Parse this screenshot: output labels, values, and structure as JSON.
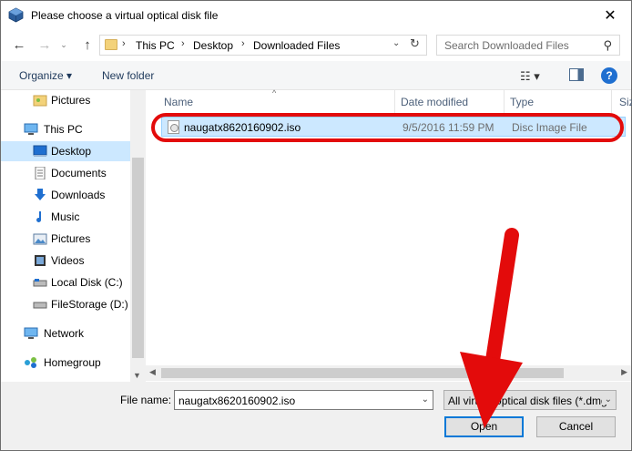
{
  "window": {
    "title": "Please choose a virtual optical disk file",
    "close_glyph": "✕"
  },
  "address": {
    "breadcrumbs": [
      "This PC",
      "Desktop",
      "Downloaded Files"
    ],
    "separator": "›"
  },
  "search": {
    "placeholder": "Search Downloaded Files"
  },
  "toolbar": {
    "organize_label": "Organize ▾",
    "new_folder_label": "New folder",
    "help_glyph": "?"
  },
  "sidebar": {
    "items": [
      {
        "label": "Pictures",
        "icon": "pictures-icon"
      },
      {
        "label": "This PC",
        "icon": "computer-icon"
      },
      {
        "label": "Desktop",
        "icon": "desktop-icon",
        "selected": true
      },
      {
        "label": "Documents",
        "icon": "documents-icon"
      },
      {
        "label": "Downloads",
        "icon": "downloads-icon"
      },
      {
        "label": "Music",
        "icon": "music-icon"
      },
      {
        "label": "Pictures",
        "icon": "pictures-icon"
      },
      {
        "label": "Videos",
        "icon": "videos-icon"
      },
      {
        "label": "Local Disk (C:)",
        "icon": "drive-icon"
      },
      {
        "label": "FileStorage (D:)",
        "icon": "drive-icon"
      },
      {
        "label": "Network",
        "icon": "network-icon"
      },
      {
        "label": "Homegroup",
        "icon": "homegroup-icon"
      }
    ]
  },
  "files": {
    "columns": [
      "Name",
      "Date modified",
      "Type",
      "Siz"
    ],
    "rows": [
      {
        "name": "naugatx8620160902.iso",
        "date": "9/5/2016 11:59 PM",
        "type": "Disc Image File",
        "selected": true
      }
    ]
  },
  "footer": {
    "filename_label": "File name:",
    "filename_value": "naugatx8620160902.iso",
    "filetype_value": "All virtual optical disk files (*.dmg",
    "open_label": "Open",
    "cancel_label": "Cancel"
  },
  "colors": {
    "highlight": "#e30b0b",
    "selection": "#cce8ff",
    "accent": "#0078d7"
  }
}
